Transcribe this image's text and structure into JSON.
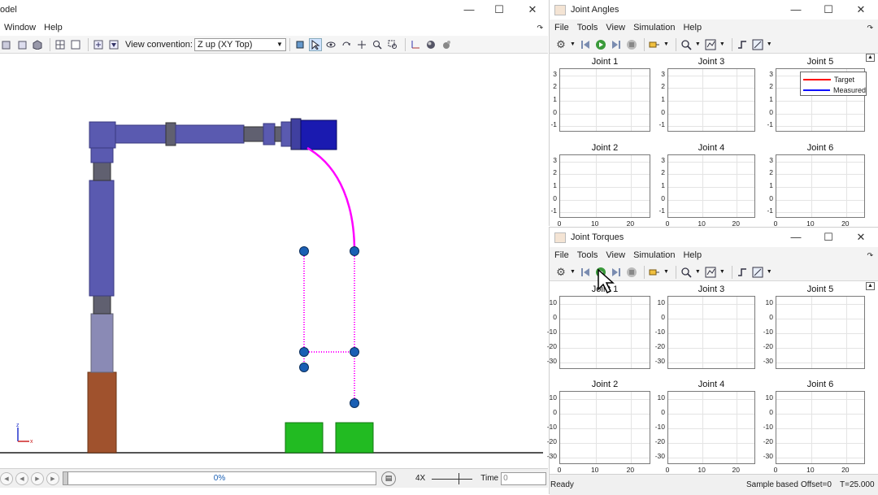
{
  "left_window": {
    "title_fragment": "odel",
    "menu": [
      "Window",
      "Help"
    ],
    "view_convention_label": "View convention:",
    "view_convention_value": "Z up (XY Top)",
    "progress_text": "0%",
    "speed_label": "4X",
    "time_label": "Time",
    "time_value": "0"
  },
  "angles_window": {
    "title": "Joint Angles",
    "menu": [
      "File",
      "Tools",
      "View",
      "Simulation",
      "Help"
    ],
    "legend": {
      "target": "Target",
      "measured": "Measured"
    },
    "plots": [
      {
        "title": "Joint 1",
        "yticks": [
          "3",
          "2",
          "1",
          "0",
          "-1"
        ]
      },
      {
        "title": "Joint 3",
        "yticks": [
          "3",
          "2",
          "1",
          "0",
          "-1"
        ]
      },
      {
        "title": "Joint 5",
        "yticks": [
          "3",
          "2",
          "1",
          "0",
          "-1"
        ]
      },
      {
        "title": "Joint 2",
        "yticks": [
          "3",
          "2",
          "1",
          "0",
          "-1"
        ]
      },
      {
        "title": "Joint 4",
        "yticks": [
          "3",
          "2",
          "1",
          "0",
          "-1"
        ]
      },
      {
        "title": "Joint 6",
        "yticks": [
          "3",
          "2",
          "1",
          "0",
          "-1"
        ]
      }
    ],
    "xticks": [
      "0",
      "10",
      "20"
    ]
  },
  "torques_window": {
    "title": "Joint Torques",
    "menu": [
      "File",
      "Tools",
      "View",
      "Simulation",
      "Help"
    ],
    "plots": [
      {
        "title": "Joint 1",
        "yticks": [
          "10",
          "0",
          "-10",
          "-20",
          "-30"
        ]
      },
      {
        "title": "Joint 3",
        "yticks": [
          "10",
          "0",
          "-10",
          "-20",
          "-30"
        ]
      },
      {
        "title": "Joint 5",
        "yticks": [
          "10",
          "0",
          "-10",
          "-20",
          "-30"
        ]
      },
      {
        "title": "Joint 2",
        "yticks": [
          "10",
          "0",
          "-10",
          "-20",
          "-30"
        ]
      },
      {
        "title": "Joint 4",
        "yticks": [
          "10",
          "0",
          "-10",
          "-20",
          "-30"
        ]
      },
      {
        "title": "Joint 6",
        "yticks": [
          "10",
          "0",
          "-10",
          "-20",
          "-30"
        ]
      }
    ],
    "xticks": [
      "0",
      "10",
      "20"
    ],
    "status": {
      "ready": "Ready",
      "mode": "Sample based",
      "offset": "Offset=0",
      "time": "T=25.000"
    }
  },
  "colors": {
    "target": "#ff0000",
    "measured": "#1010ff",
    "trajectory": "#ff00ff",
    "robot_link": "#5a5ab0",
    "robot_base": "#a0522d",
    "blocks": "#22bb22"
  },
  "axis_labels": {
    "z": "z",
    "x": "x"
  }
}
